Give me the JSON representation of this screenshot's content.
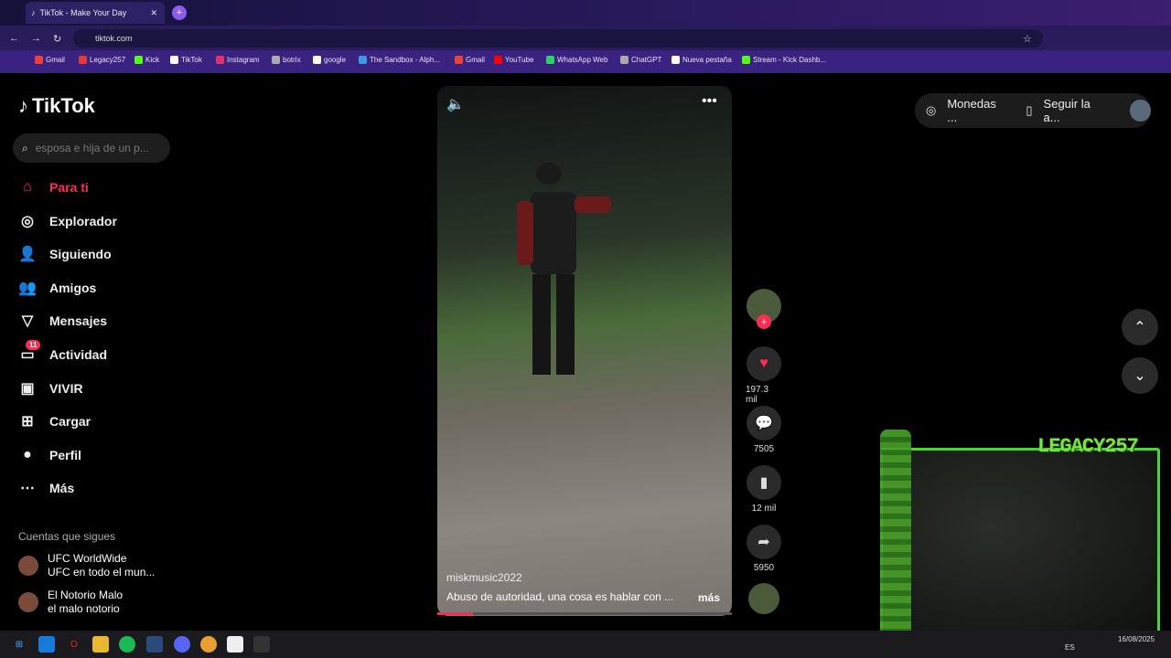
{
  "browser": {
    "tab_title": "TikTok - Make Your Day",
    "url": "tiktok.com",
    "bookmarks": [
      "Gmail",
      "Legacy257",
      "Kick",
      "TikTok",
      "Instagram",
      "botrix",
      "google",
      "The Sandbox - Alph...",
      "Gmail",
      "YouTube",
      "WhatsApp Web",
      "ChatGPT",
      "Nueva pestaña",
      "Stream - Kick Dashb..."
    ]
  },
  "sidebar": {
    "logo": "TikTok",
    "search_placeholder": "esposa e hija de un p...",
    "nav": [
      {
        "label": "Para ti",
        "icon": "home-icon",
        "active": true
      },
      {
        "label": "Explorador",
        "icon": "compass-icon"
      },
      {
        "label": "Siguiendo",
        "icon": "following-icon"
      },
      {
        "label": "Amigos",
        "icon": "friends-icon"
      },
      {
        "label": "Mensajes",
        "icon": "send-icon"
      },
      {
        "label": "Actividad",
        "icon": "activity-icon",
        "badge": "11"
      },
      {
        "label": "VIVIR",
        "icon": "live-icon"
      },
      {
        "label": "Cargar",
        "icon": "upload-icon"
      },
      {
        "label": "Perfil",
        "icon": "profile-icon"
      },
      {
        "label": "Más",
        "icon": "more-icon"
      }
    ],
    "following_title": "Cuentas que sigues",
    "accounts": [
      {
        "name": "UFC WorldWide",
        "sub": "UFC en todo el mun..."
      },
      {
        "name": "El Notorio Malo",
        "sub": "el malo notorio"
      }
    ]
  },
  "video": {
    "username": "miskmusic2022",
    "description": "Abuso de autoridad, una cosa es hablar con ...",
    "more": "más",
    "progress": 0.12
  },
  "actions": {
    "likes": "197.3 mil",
    "comments": "7505",
    "saves": "12 mil",
    "shares": "5950"
  },
  "topright": {
    "coins": "Monedas ...",
    "follow_app": "Seguir la a..."
  },
  "overlay": {
    "cam_title": "LEGACY257"
  },
  "taskbar": {
    "lang": "ES",
    "date": "16/08/2025"
  },
  "colors": {
    "accent": "#fe2c55",
    "overlay_green": "#4bd62a"
  }
}
